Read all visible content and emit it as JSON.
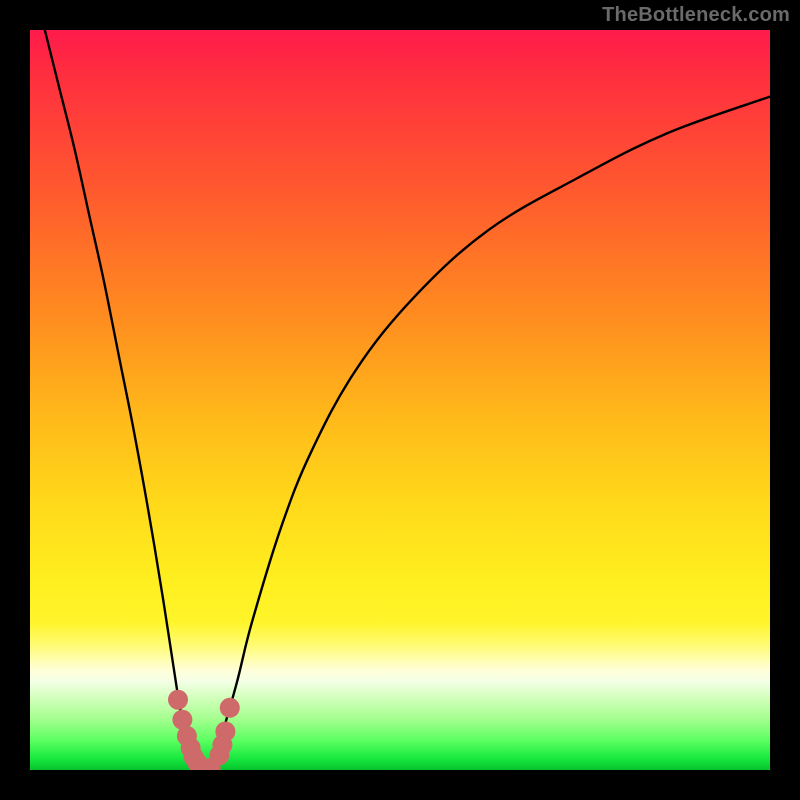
{
  "watermark": "TheBottleneck.com",
  "colors": {
    "frame": "#000000",
    "curve": "#000000",
    "marker": "#cf6a6a",
    "gradient_top": "#ff1b4c",
    "gradient_bottom": "#06c22e"
  },
  "chart_data": {
    "type": "line",
    "title": "",
    "xlabel": "",
    "ylabel": "",
    "xlim": [
      0,
      100
    ],
    "ylim": [
      0,
      100
    ],
    "grid": false,
    "series": [
      {
        "name": "bottleneck-curve",
        "x": [
          2,
          4,
          6,
          8,
          10,
          12,
          14,
          16,
          18,
          20,
          21,
          22,
          23,
          24,
          25,
          26,
          28,
          30,
          34,
          38,
          44,
          52,
          62,
          74,
          86,
          100
        ],
        "y": [
          100,
          92,
          84,
          75,
          66,
          56,
          46,
          35,
          23,
          10,
          5,
          2,
          0,
          0,
          2,
          5,
          12,
          20,
          33,
          43,
          54,
          64,
          73,
          80,
          86,
          91
        ]
      }
    ],
    "markers": {
      "name": "highlight-cluster",
      "x": [
        20.0,
        20.6,
        21.2,
        21.7,
        22.1,
        22.6,
        23.3,
        24.4,
        25.6,
        26.0,
        26.4,
        27.0
      ],
      "y": [
        9.5,
        6.8,
        4.6,
        3.0,
        1.8,
        1.0,
        0.3,
        0.3,
        2.0,
        3.4,
        5.2,
        8.4
      ]
    }
  }
}
